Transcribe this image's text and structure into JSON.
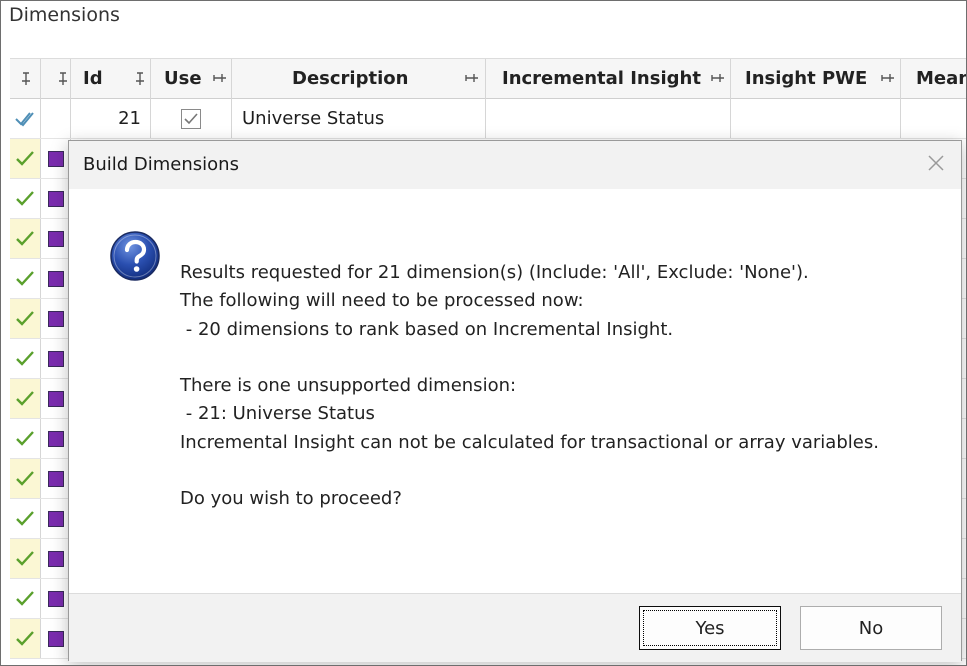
{
  "panel": {
    "title": "Dimensions"
  },
  "grid": {
    "columns": {
      "id": "Id",
      "use": "Use",
      "description": "Description",
      "incremental_insight": "Incremental Insight",
      "insight_pwe": "Insight PWE",
      "partial": "Mean"
    },
    "first_row": {
      "id": "21",
      "description": "Universe Status"
    },
    "swatch_color": "#7a2cae",
    "check_color": "#5aa02c"
  },
  "dialog": {
    "title": "Build Dimensions",
    "lines": [
      "Results requested for 21 dimension(s) (Include: 'All', Exclude: 'None').",
      "The following will need to be processed now:",
      " - 20 dimensions to rank based on Incremental Insight.",
      "",
      "There is one unsupported dimension:",
      " - 21: Universe Status",
      "Incremental Insight can not be calculated for transactional or array variables.",
      "",
      "Do you wish to proceed?"
    ],
    "yes_label": "Yes",
    "no_label": "No"
  }
}
